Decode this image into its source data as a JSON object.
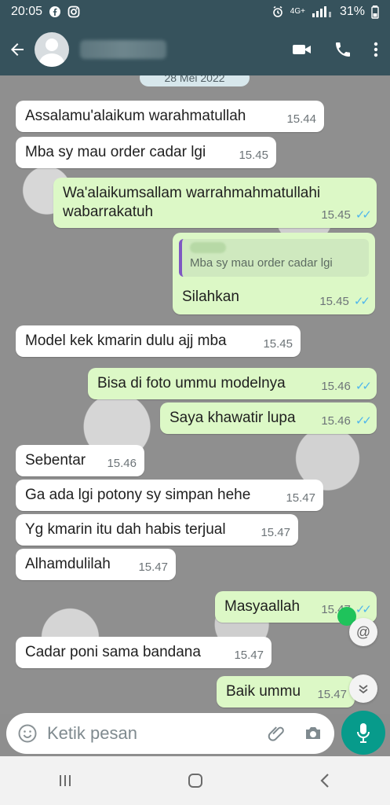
{
  "status": {
    "time": "20:05",
    "network": "4G+",
    "battery": "31%"
  },
  "chat": {
    "date_chip": "28 Mei 2022",
    "messages": [
      {
        "text": "Assalamu'alaikum warahmatullah",
        "time": "15.44"
      },
      {
        "text": "Mba sy mau order cadar lgi",
        "time": "15.45"
      },
      {
        "text": "Wa'alaikumsallam warrahmahmatullahi\nwabarrakatuh",
        "time": "15.45"
      },
      {
        "quote_text": "Mba sy mau order cadar lgi",
        "text": "Silahkan",
        "time": "15.45"
      },
      {
        "text": "Model kek kmarin dulu ajj mba",
        "time": "15.45"
      },
      {
        "text": "Bisa di foto ummu modelnya",
        "time": "15.46"
      },
      {
        "text": "Saya khawatir lupa",
        "time": "15.46"
      },
      {
        "text": "Sebentar",
        "time": "15.46"
      },
      {
        "text": "Ga ada lgi potony sy simpan hehe",
        "time": "15.47"
      },
      {
        "text": "Yg kmarin itu dah habis terjual",
        "time": "15.47"
      },
      {
        "text": "Alhamdulilah",
        "time": "15.47"
      },
      {
        "text": "Masyaallah",
        "time": "15.47"
      },
      {
        "text": "Cadar poni sama bandana",
        "time": "15.47"
      },
      {
        "text": "Baik ummu",
        "time": "15.47"
      }
    ]
  },
  "composer": {
    "placeholder": "Ketik pesan"
  },
  "icons": {
    "back": "back-arrow-icon",
    "video": "video-call-icon",
    "call": "phone-call-icon",
    "menu": "more-options-icon",
    "emoji": "emoji-icon",
    "attach": "attach-icon",
    "camera": "camera-icon",
    "mic": "microphone-icon"
  },
  "colors": {
    "header": "#36525c",
    "incoming": "#ffffff",
    "outgoing": "#dcf8c6",
    "accent": "#079b8b"
  }
}
